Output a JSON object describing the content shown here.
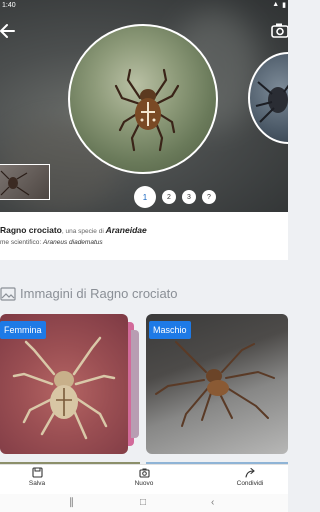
{
  "status": {
    "time": "1:40"
  },
  "pager": [
    "1",
    "2",
    "3",
    "?"
  ],
  "species": {
    "common_name": "Ragno crociato",
    "species_of": ", una specie di ",
    "family": "Araneidae",
    "scientific_label": "me scientifico: ",
    "scientific_name": "Araneus diadematus"
  },
  "gallery": {
    "title": "Immagini di Ragno crociato",
    "cards": [
      {
        "label": "Femmina"
      },
      {
        "label": "Maschio"
      }
    ]
  },
  "bottom_nav": {
    "save": "Salva",
    "new": "Nuovo",
    "share": "Condividi"
  },
  "colors": {
    "accent": "#1e7ae6"
  }
}
